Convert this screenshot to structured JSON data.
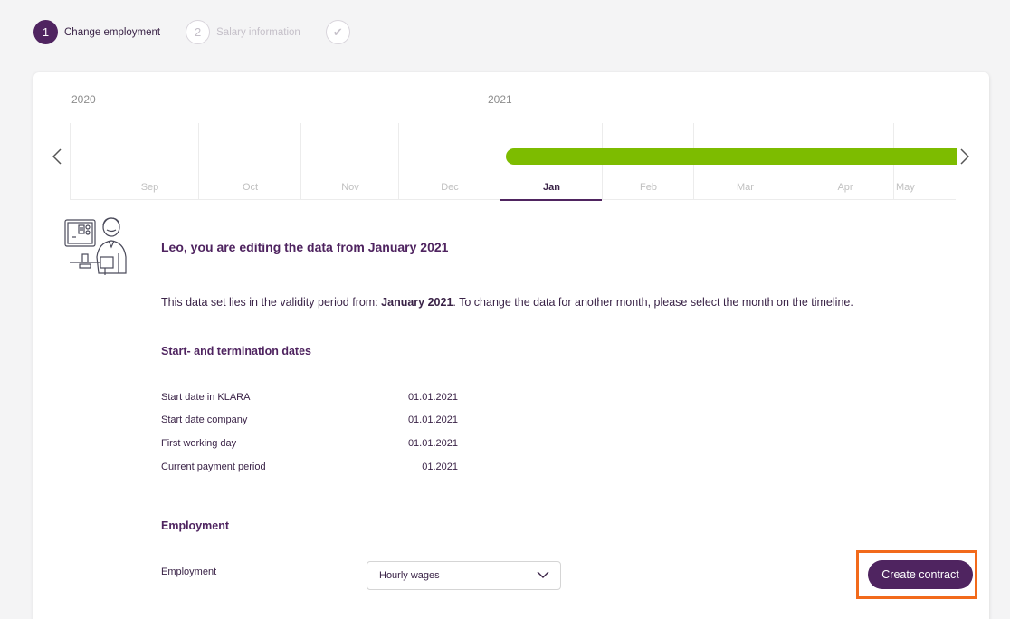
{
  "stepper": {
    "steps": [
      {
        "number": "1",
        "label": "Change employment",
        "state": "active"
      },
      {
        "number": "2",
        "label": "Salary information",
        "state": "inactive"
      },
      {
        "icon": "check-icon",
        "state": "inactive"
      }
    ]
  },
  "timeline": {
    "years": [
      "2020",
      "2021"
    ],
    "months": [
      "Sep",
      "Oct",
      "Nov",
      "Dec",
      "Jan",
      "Feb",
      "Mar",
      "Apr",
      "May"
    ],
    "active_month": "Jan",
    "bar_color": "#7dbc00",
    "prev_icon": "chevron-left-icon",
    "next_icon": "chevron-right-icon"
  },
  "content": {
    "title": "Leo, you are editing the data from January 2021",
    "info_prefix": "This data set lies in the validity period from: ",
    "info_period": "January 2021",
    "info_suffix": ". To change the data for another month, please select the month on the timeline.",
    "dates_section_title": "Start- and termination dates",
    "dates": [
      {
        "label": "Start date in KLARA",
        "value": "01.01.2021"
      },
      {
        "label": "Start date company",
        "value": "01.01.2021"
      },
      {
        "label": "First working day",
        "value": "01.01.2021"
      },
      {
        "label": "Current payment period",
        "value": "01.2021"
      }
    ],
    "employment_section_title": "Employment",
    "employment_label": "Employment",
    "employment_value": "Hourly wages",
    "create_button_label": "Create contract"
  },
  "colors": {
    "brand": "#4f2460",
    "accent_green": "#7dbc00",
    "highlight": "#f26a1b"
  }
}
